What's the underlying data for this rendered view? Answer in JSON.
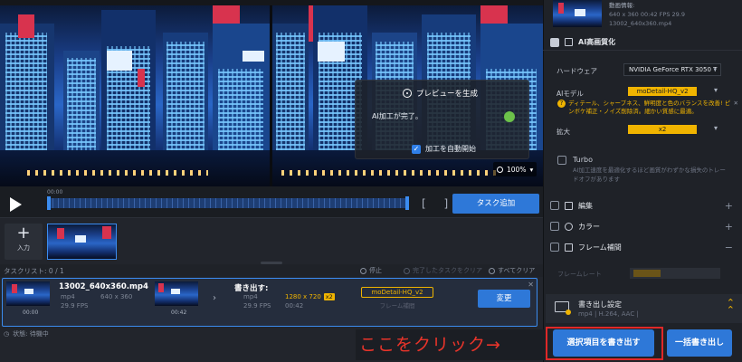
{
  "preview": {
    "generate_title": "プレビューを生成",
    "ai_done": "AI加工が完了。",
    "auto_start_label": "加工を自動開始",
    "auto_start_checked": true,
    "zoom": "100%"
  },
  "controls": {
    "time_start": "00:00",
    "task_add": "タスク追加"
  },
  "thumbs": {
    "add_label": "入力"
  },
  "task_list": {
    "header": "タスクリスト: 0 / 1",
    "stop": "停止",
    "clear_done": "完了したタスクをクリア",
    "clear_all": "すべてクリア"
  },
  "task": {
    "src_name": "13002_640x360.mp4",
    "src_format": "mp4",
    "src_res": "640 x 360",
    "src_fps": "29.9 FPS",
    "src_dur": "00:42",
    "src_time": "00:00",
    "out_time": "00:42",
    "out_title": "書き出す:",
    "out_format": "mp4",
    "out_res": "1280 x 720",
    "out_badge": "x2",
    "out_fps": "29.9 FPS",
    "out_dur": "00:42",
    "model": "moDetail-HQ_v2",
    "model_sub": "フレーム補間",
    "change": "変更",
    "status": "状態: 待機中"
  },
  "panel": {
    "info_title": "動画情報:",
    "info_line1": "640 x 360  00:42  FPS 29.9",
    "info_line2": "13002_640x360.mp4",
    "ai_section": "AI高画質化",
    "hardware_label": "ハードウェア",
    "hardware_value": "NVIDIA GeForce RTX 3050 T",
    "ai_model_label": "AIモデル",
    "ai_model_value": "moDetail-HQ_v2",
    "hint": "ディテール、シャープネス、鮮明度と色のバランスを改善! ピンボケ補正・ノイズ削除済。細かい質感に最適。",
    "scale_label": "拡大",
    "scale_value": "x2",
    "turbo_label": "Turbo",
    "turbo_desc": "AI加工速度を最適化するほど画質がわずかな損失のトレードオフがあります",
    "edit_section": "編集",
    "color_section": "カラー",
    "frame_section": "フレーム補間",
    "frame_rate_label": "フレームレート",
    "export_title": "書き出し設定",
    "export_sub": "mp4 | H.264, AAC |",
    "btn_export_selected": "選択項目を書き出す",
    "btn_export_all": "一括書き出し"
  },
  "annotation": "ここをクリック→",
  "colors": {
    "accent": "#2e78d8",
    "highlight": "#e02828",
    "annotation": "#e8342a",
    "yellow": "#f0b400"
  }
}
